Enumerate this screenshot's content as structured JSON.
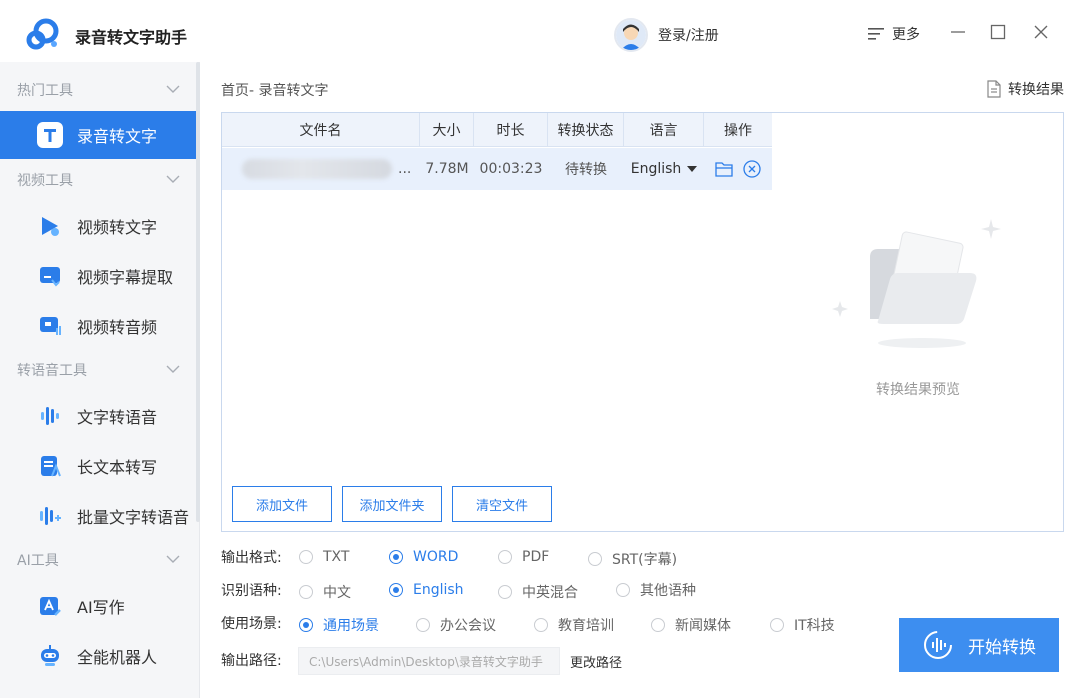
{
  "app": {
    "title": "录音转文字助手"
  },
  "header": {
    "login_label": "登录/注册",
    "more_label": "更多"
  },
  "sidebar": {
    "groups": [
      {
        "label": "热门工具"
      },
      {
        "label": "视频工具"
      },
      {
        "label": "转语音工具"
      },
      {
        "label": "AI工具"
      }
    ],
    "items": [
      {
        "label": "录音转文字",
        "icon": "text-t-icon"
      },
      {
        "label": "视频转文字",
        "icon": "video-play-icon"
      },
      {
        "label": "视频字幕提取",
        "icon": "video-subtitle-icon"
      },
      {
        "label": "视频转音频",
        "icon": "video-audio-icon"
      },
      {
        "label": "文字转语音",
        "icon": "waveform-icon"
      },
      {
        "label": "长文本转写",
        "icon": "long-text-icon"
      },
      {
        "label": "批量文字转语音",
        "icon": "batch-voice-icon"
      },
      {
        "label": "AI写作",
        "icon": "ai-write-icon"
      },
      {
        "label": "全能机器人",
        "icon": "robot-icon"
      }
    ]
  },
  "main": {
    "breadcrumb": "首页- 录音转文字",
    "result_link": "转换结果",
    "table": {
      "headers": [
        "文件名",
        "大小",
        "时长",
        "转换状态",
        "语言",
        "操作"
      ],
      "rows": [
        {
          "name_suffix": "...",
          "size": "7.78M",
          "duration": "00:03:23",
          "status": "待转换",
          "language": "English"
        }
      ]
    },
    "buttons": {
      "add_file": "添加文件",
      "add_folder": "添加文件夹",
      "clear_files": "清空文件"
    },
    "preview_text": "转换结果预览"
  },
  "options": {
    "format": {
      "label": "输出格式:",
      "choices": [
        "TXT",
        "WORD",
        "PDF",
        "SRT(字幕)"
      ],
      "selected": "WORD"
    },
    "language": {
      "label": "识别语种:",
      "choices": [
        "中文",
        "English",
        "中英混合",
        "其他语种"
      ],
      "selected": "English"
    },
    "scene": {
      "label": "使用场景:",
      "choices": [
        "通用场景",
        "办公会议",
        "教育培训",
        "新闻媒体",
        "IT科技"
      ],
      "selected": "通用场景"
    },
    "output": {
      "label": "输出路径:",
      "path": "C:\\Users\\Admin\\Desktop\\录音转文字助手",
      "change_label": "更改路径"
    }
  },
  "start_button": {
    "label": "开始转换"
  },
  "colors": {
    "accent": "#2b7de9",
    "start_button": "#3d8ef0",
    "sidebar_bg": "#f5f6f8"
  }
}
